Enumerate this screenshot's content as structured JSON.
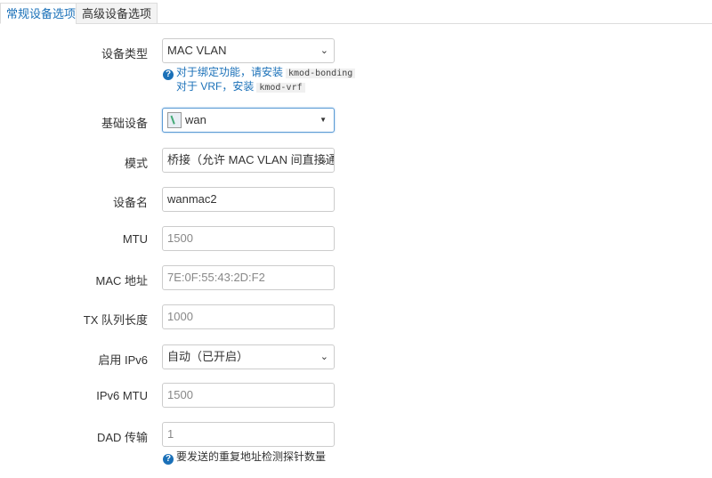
{
  "tabs": [
    {
      "label": "常规设备选项",
      "active": true
    },
    {
      "label": "高级设备选项",
      "active": false
    }
  ],
  "form": {
    "device_type": {
      "label": "设备类型",
      "value": "MAC VLAN"
    },
    "help_bonding": {
      "text": "对于绑定功能，请安装",
      "code": "kmod-bonding"
    },
    "help_vrf": {
      "text": "对于 VRF，安装",
      "code": "kmod-vrf"
    },
    "base_device": {
      "label": "基础设备",
      "value": "wan"
    },
    "mode": {
      "label": "模式",
      "value": "桥接（允许 MAC VLAN 间直接通"
    },
    "device_name": {
      "label": "设备名",
      "value": "wanmac2"
    },
    "mtu": {
      "label": "MTU",
      "placeholder": "1500"
    },
    "mac": {
      "label": "MAC 地址",
      "placeholder": "7E:0F:55:43:2D:F2"
    },
    "txqueue": {
      "label": "TX 队列长度",
      "placeholder": "1000"
    },
    "ipv6": {
      "label": "启用 IPv6",
      "value": "自动（已开启）"
    },
    "ipv6_mtu": {
      "label": "IPv6 MTU",
      "placeholder": "1500"
    },
    "dad": {
      "label": "DAD 传输",
      "placeholder": "1"
    },
    "help_dad": {
      "text": "要发送的重复地址检测探针数量"
    }
  },
  "colors": {
    "accent": "#1a70b8",
    "border": "#cccccc",
    "focus_border": "#5b9bd5"
  },
  "icons": {
    "help": "question-circle-icon",
    "dropdown": "chevron-down-icon",
    "device": "ethernet-port-icon"
  }
}
